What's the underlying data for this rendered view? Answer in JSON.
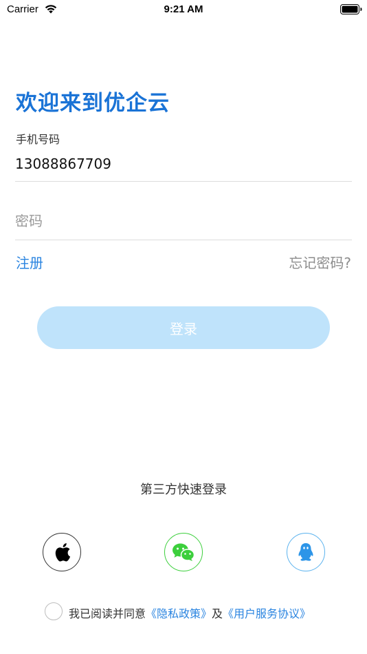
{
  "status_bar": {
    "carrier": "Carrier",
    "time": "9:21 AM",
    "wifi_icon": "wifi-icon",
    "battery_icon": "battery-icon"
  },
  "header": {
    "title": "欢迎来到优企云"
  },
  "form": {
    "phone_label": "手机号码",
    "phone_value": "13088867709",
    "password_placeholder": "密码",
    "register_label": "注册",
    "forgot_label": "忘记密码?",
    "login_label": "登录"
  },
  "third_party": {
    "title": "第三方快速登录",
    "providers": [
      {
        "name": "apple",
        "icon": "apple-icon"
      },
      {
        "name": "wechat",
        "icon": "wechat-icon"
      },
      {
        "name": "qq",
        "icon": "qq-icon"
      }
    ]
  },
  "agreement": {
    "prefix": "我已阅读并同意",
    "privacy_link": "《隐私政策》",
    "conjunction": "及",
    "terms_link": "《用户服务协议》"
  },
  "colors": {
    "accent": "#1a73d6",
    "link": "#2a84e0",
    "login_button": "#bfe3fb",
    "wechat": "#3ccf3c",
    "qq": "#5ab2ee"
  }
}
